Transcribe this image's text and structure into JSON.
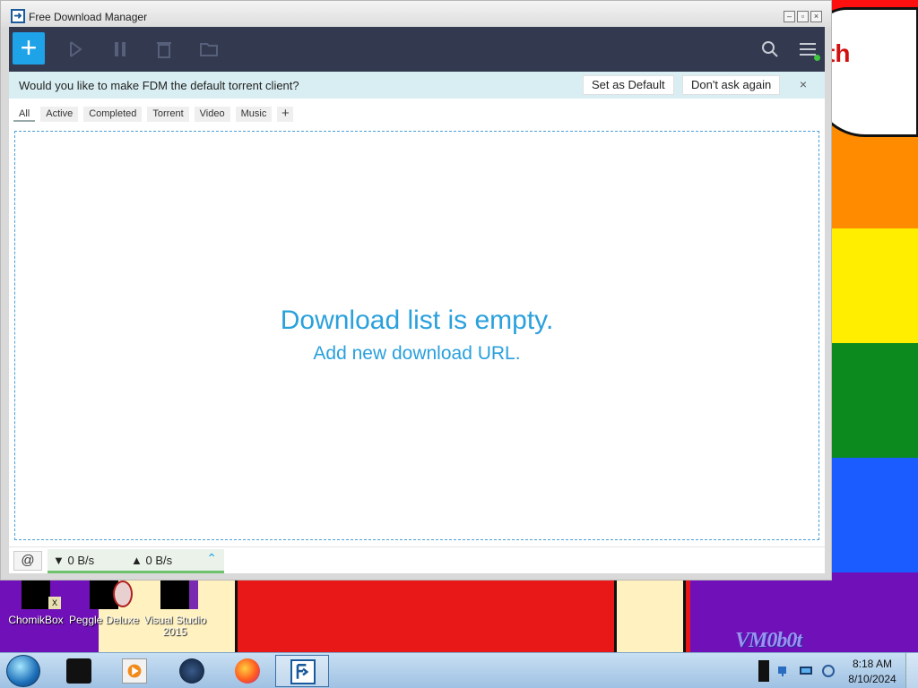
{
  "window": {
    "title": "Free Download Manager",
    "controls": {
      "minimize": "–",
      "restore": "▫",
      "close": "×"
    }
  },
  "toolbar": {
    "add_label": "+",
    "icons": [
      "add-download-icon",
      "start-icon",
      "pause-icon",
      "delete-icon",
      "open-folder-icon",
      "search-icon",
      "menu-icon"
    ]
  },
  "banner": {
    "text": "Would you like to make FDM the default torrent client?",
    "set_default": "Set as Default",
    "dont_ask": "Don't ask again",
    "close": "×"
  },
  "tabs": [
    "All",
    "Active",
    "Completed",
    "Torrent",
    "Video",
    "Music"
  ],
  "tab_add": "+",
  "empty_state": {
    "title": "Download list is empty.",
    "subtitle": "Add new download URL."
  },
  "status": {
    "download_speed": "▼ 0 B/s",
    "upload_speed": "▲ 0 B/s"
  },
  "desktop": {
    "bubble_text": "th",
    "watermark": "VM0b0t",
    "icons": [
      {
        "label": "ChomikBox"
      },
      {
        "label": "Peggle Deluxe"
      },
      {
        "label": "Visual Studio 2015"
      }
    ]
  },
  "taskbar": {
    "time": "8:18 AM",
    "date": "8/10/2024"
  },
  "colors": {
    "accent": "#1fa3e8",
    "toolbar": "#333a4f",
    "banner": "#d9eef2"
  }
}
